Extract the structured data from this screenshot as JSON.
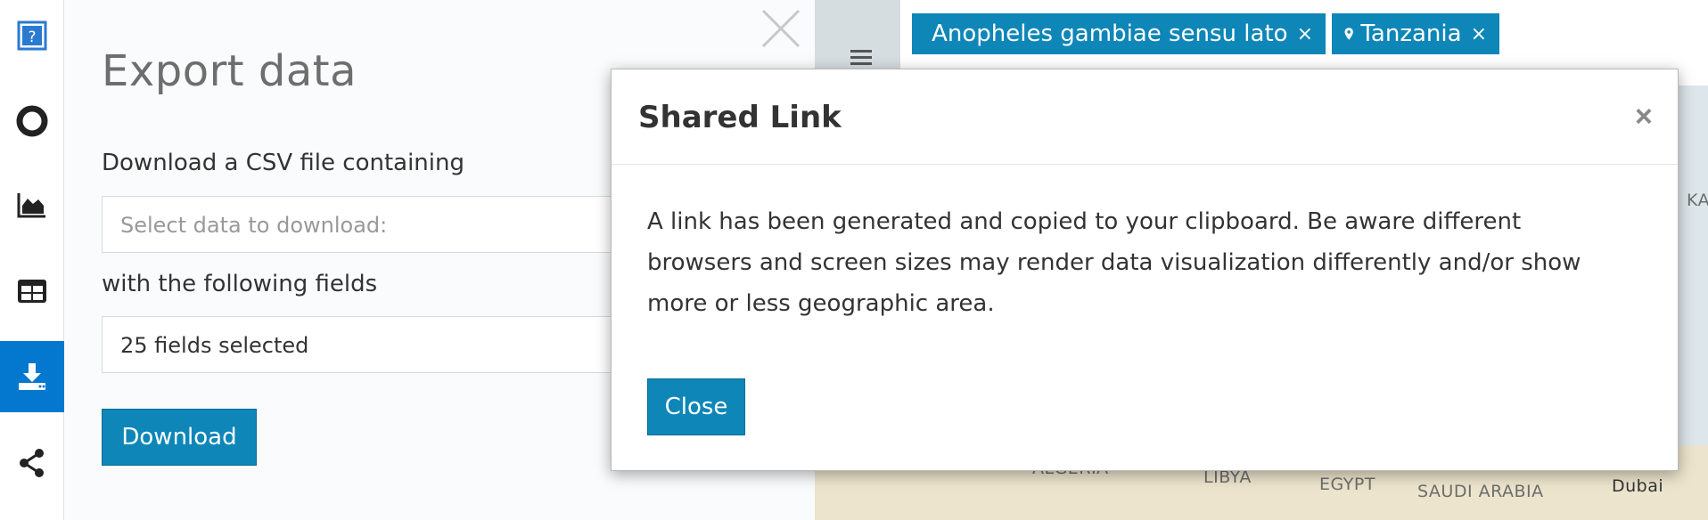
{
  "sidebar": {
    "items": [
      {
        "icon": "help-icon"
      },
      {
        "icon": "circle-ring-icon"
      },
      {
        "icon": "area-chart-icon"
      },
      {
        "icon": "table-icon"
      },
      {
        "icon": "download-icon",
        "active": true
      },
      {
        "icon": "share-icon"
      }
    ]
  },
  "export": {
    "title": "Export data",
    "csv_label": "Download a CSV file containing",
    "data_placeholder": "Select data to download:",
    "fields_label": "with the following fields",
    "fields_value": "25 fields selected",
    "download_label": "Download"
  },
  "filters": {
    "species": "Anopheles gambiae sensu lato",
    "country": "Tanzania",
    "remove_glyph": "×"
  },
  "map": {
    "labels": [
      "ALGERIA",
      "LIBYA",
      "EGYPT",
      "SAUDI ARABIA",
      "Dubai",
      "KA"
    ]
  },
  "modal": {
    "title": "Shared Link",
    "close_glyph": "×",
    "message": "A link has been generated and copied to your clipboard. Be aware different browsers and screen sizes may render data visualization differently and/or show more or less geographic area.",
    "close_label": "Close"
  },
  "colors": {
    "accent": "#0e86b8",
    "sidebar_active": "#0378ce"
  }
}
